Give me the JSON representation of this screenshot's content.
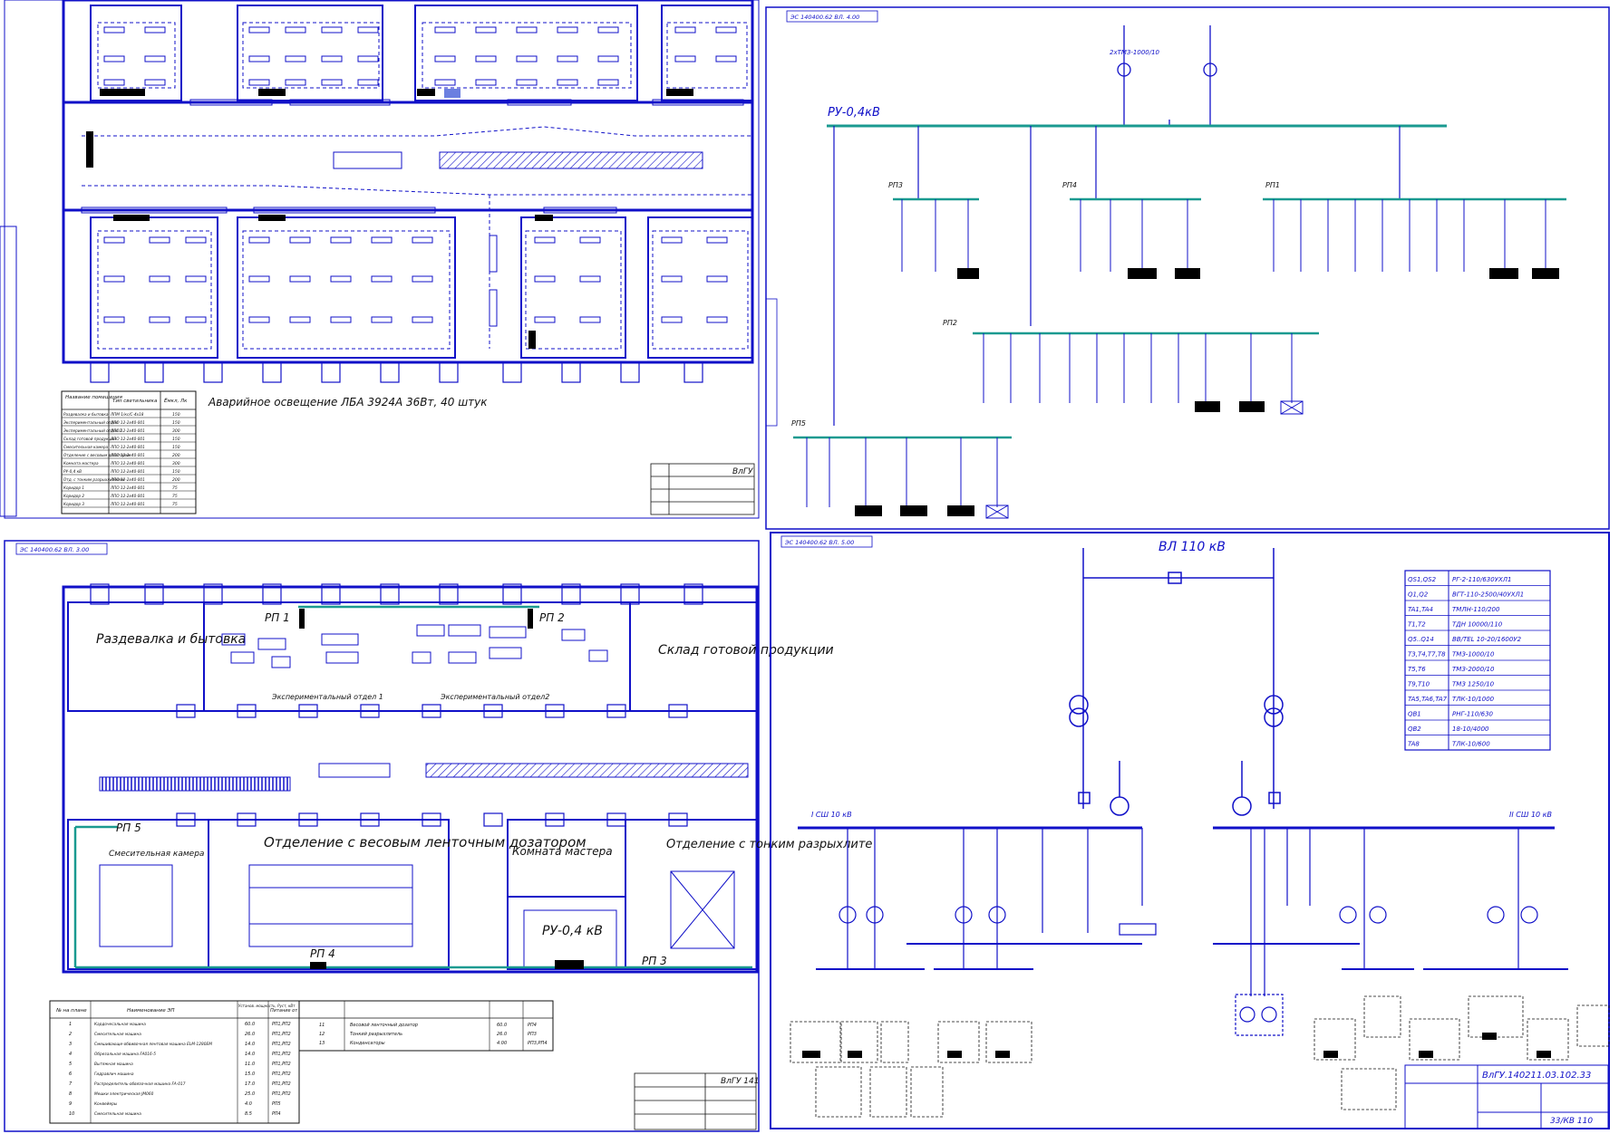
{
  "top_left": {
    "note": "Аварийное освещение ЛБА 3924А 36Вт, 40 штук",
    "legend_headers": [
      "Название помещения",
      "Тип светильника",
      "Ёмкл, Лк"
    ],
    "legend_rows": [
      [
        "Раздевалка и бытовка",
        "ЛПМ 1/кс/С-4х18",
        "150"
      ],
      [
        "Экспериментальный отдел",
        "ЛПО 12-2х40-001",
        "150"
      ],
      [
        "Экспериментальный отдел 2",
        "ЛПО 12-2х40-001",
        "300"
      ],
      [
        "Склад готовой продукции",
        "ЛПО 12-2х40-001",
        "150"
      ],
      [
        "Смесительная камера",
        "ЛПО 12-2х40-001",
        "150"
      ],
      [
        "Отделение с весовым дозатором",
        "ЛПО 12-2х40-001",
        "200"
      ],
      [
        "Комната мастера",
        "ЛПО 12-2х40-001",
        "300"
      ],
      [
        "РУ-0,4 кВ",
        "ЛПО 12-2х40-001",
        "150"
      ],
      [
        "Отд. с тонким разрыхлителем",
        "ЛПО 12-2х40-001",
        "200"
      ],
      [
        "Коридор 1",
        "ЛПО 12-2х40-001",
        "75"
      ],
      [
        "Коридор 2",
        "ЛПО 12-2х40-001",
        "75"
      ],
      [
        "Коридор 3",
        "ЛПО 12-2х40-001",
        "75"
      ]
    ],
    "stamp": "ВлГУ"
  },
  "top_right": {
    "header": "ЭС 140400.62 ВЛ. 4.00",
    "bus": "РУ-0,4кВ",
    "transformers": "2хТМЗ-1000/10",
    "panels": [
      "РП3",
      "РП4",
      "РП1",
      "РП2",
      "РП5"
    ]
  },
  "bottom_left": {
    "header": "ЭС 140400.62 ВЛ. 3.00",
    "rooms": {
      "room1": "Раздевалка и бытовка",
      "room2": "Склад готовой продукции",
      "room3": "Экспериментальный отдел 1",
      "room4": "Экспериментальный отдел2",
      "room5": "Отделение с весовым ленточным дозатором",
      "room6": "Комната мастера",
      "room7": "Отделение с тонким разрыхлите",
      "room8": "Смесительная камера",
      "room9": "РУ-0,4 кВ"
    },
    "panels": [
      "РП 1",
      "РП 2",
      "РП 3",
      "РП 4",
      "РП 5"
    ],
    "table_headers": [
      "№ на плане",
      "Наименование ЭП",
      "Установ. мощность, Руст, кВт",
      "Питание от"
    ],
    "table_rows": [
      [
        "1",
        "Кардочесальная машина",
        "60.0",
        "РП1,РП2"
      ],
      [
        "2",
        "Смесительная машина",
        "26.0",
        "РП1,РП2"
      ],
      [
        "3",
        "Смешивающе-обвивочная лентовая машина ELM-1280EM",
        "14.0",
        "РП1,РП2"
      ],
      [
        "4",
        "Обрезальная машина FA016-5",
        "14.0",
        "РП1,РП2"
      ],
      [
        "5",
        "Вытяжная машина",
        "11.0",
        "РП1,РП2"
      ],
      [
        "6",
        "Гидравлич машина",
        "15.0",
        "РП1,РП2"
      ],
      [
        "7",
        "Распределитель-обвязочная машина FA-017",
        "17.0",
        "РП1,РП2"
      ],
      [
        "8",
        "Мешки электрическая JM060",
        "25.0",
        "РП1,РП2"
      ],
      [
        "9",
        "Конвейеры",
        "4.0",
        "РП5"
      ],
      [
        "10",
        "Смесительная машина",
        "8.5",
        "РП4"
      ]
    ],
    "table2_rows": [
      [
        "11",
        "Весовой ленточный дозатор",
        "60.0",
        "РП4"
      ],
      [
        "12",
        "Тонкий разрыхлитель",
        "26.0",
        "РП3"
      ],
      [
        "13",
        "Конденсаторы",
        "4.00",
        "РП3,РП4"
      ]
    ],
    "stamp": "ВлГУ 141"
  },
  "bottom_right": {
    "header": "ЭС 140400.62 ВЛ. 5.00",
    "title": "ВЛ 110 кВ",
    "bus_left": "I СШ 10 кВ",
    "bus_right": "II СШ 10 кВ",
    "equipment_table": [
      [
        "QS1,QS2",
        "РГ-2-110/630УХЛ1"
      ],
      [
        "Q1,Q2",
        "ВГТ-110-2500/40УХЛ1"
      ],
      [
        "TA1,TA4",
        "ТМЛН-110/200"
      ],
      [
        "T1,T2",
        "ТДН 10000/110"
      ],
      [
        "Q5..Q14",
        "ВВ/TEL 10-20/1600У2"
      ],
      [
        "T3,T4,T7,T8",
        "ТМЗ-1000/10"
      ],
      [
        "T5,T6",
        "ТМЗ-2000/10"
      ],
      [
        "T9,T10",
        "ТМЗ 1250/10"
      ],
      [
        "TA5,TA6,TA7",
        "ТЛК-10/1000"
      ],
      [
        "QB1",
        "РНГ-110/630"
      ],
      [
        "QB2",
        "18-10/4000"
      ],
      [
        "TA8",
        "ТЛК-10/600"
      ]
    ],
    "stamp_code": "ВлГУ.140211.03.102.33",
    "stamp_sheet": "33/КВ 110"
  },
  "colors": {
    "line": "#1010c8",
    "accent": "#2a9a90",
    "black": "#000000"
  }
}
